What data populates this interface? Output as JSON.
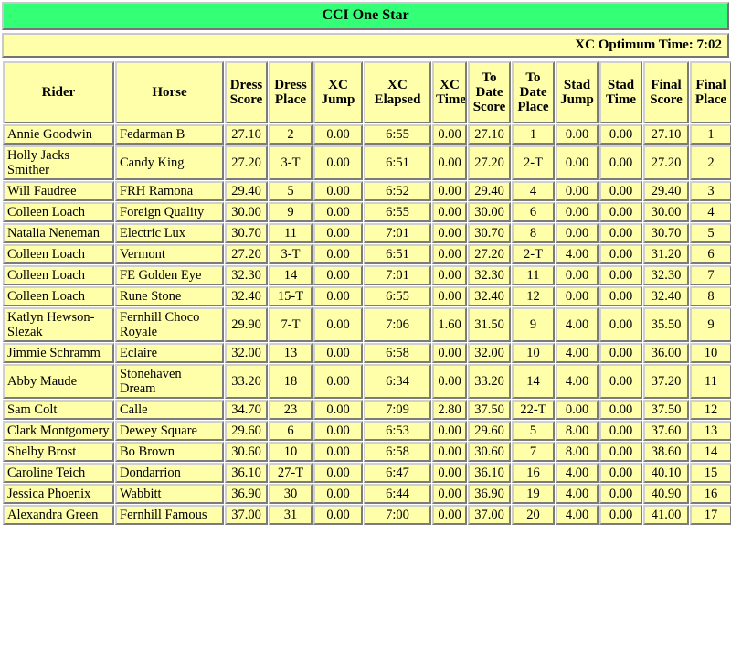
{
  "banner": {
    "title": "CCI One Star",
    "optimum_time_label": "XC Optimum Time: 7:02",
    "banner_color": "#33ff77",
    "cell_color": "#ffffaa"
  },
  "table": {
    "columns": [
      {
        "key": "rider",
        "label": "Rider"
      },
      {
        "key": "horse",
        "label": "Horse"
      },
      {
        "key": "dress_score",
        "label": "Dress Score"
      },
      {
        "key": "dress_place",
        "label": "Dress Place"
      },
      {
        "key": "xc_jump",
        "label": "XC Jump"
      },
      {
        "key": "xc_elapsed",
        "label": "XC Elapsed"
      },
      {
        "key": "xc_time",
        "label": "XC Time"
      },
      {
        "key": "td_score",
        "label": "To Date Score"
      },
      {
        "key": "td_place",
        "label": "To Date Place"
      },
      {
        "key": "stad_jump",
        "label": "Stad Jump"
      },
      {
        "key": "stad_time",
        "label": "Stad Time"
      },
      {
        "key": "final_score",
        "label": "Final Score"
      },
      {
        "key": "final_place",
        "label": "Final Place"
      }
    ],
    "rows": [
      {
        "rider": "Annie Goodwin",
        "horse": "Fedarman B",
        "dress_score": "27.10",
        "dress_place": "2",
        "xc_jump": "0.00",
        "xc_elapsed": "6:55",
        "xc_time": "0.00",
        "td_score": "27.10",
        "td_place": "1",
        "stad_jump": "0.00",
        "stad_time": "0.00",
        "final_score": "27.10",
        "final_place": "1"
      },
      {
        "rider": "Holly Jacks Smither",
        "horse": "Candy King",
        "dress_score": "27.20",
        "dress_place": "3-T",
        "xc_jump": "0.00",
        "xc_elapsed": "6:51",
        "xc_time": "0.00",
        "td_score": "27.20",
        "td_place": "2-T",
        "stad_jump": "0.00",
        "stad_time": "0.00",
        "final_score": "27.20",
        "final_place": "2"
      },
      {
        "rider": "Will Faudree",
        "horse": "FRH Ramona",
        "dress_score": "29.40",
        "dress_place": "5",
        "xc_jump": "0.00",
        "xc_elapsed": "6:52",
        "xc_time": "0.00",
        "td_score": "29.40",
        "td_place": "4",
        "stad_jump": "0.00",
        "stad_time": "0.00",
        "final_score": "29.40",
        "final_place": "3"
      },
      {
        "rider": "Colleen Loach",
        "horse": "Foreign Quality",
        "dress_score": "30.00",
        "dress_place": "9",
        "xc_jump": "0.00",
        "xc_elapsed": "6:55",
        "xc_time": "0.00",
        "td_score": "30.00",
        "td_place": "6",
        "stad_jump": "0.00",
        "stad_time": "0.00",
        "final_score": "30.00",
        "final_place": "4"
      },
      {
        "rider": "Natalia Neneman",
        "horse": "Electric Lux",
        "dress_score": "30.70",
        "dress_place": "11",
        "xc_jump": "0.00",
        "xc_elapsed": "7:01",
        "xc_time": "0.00",
        "td_score": "30.70",
        "td_place": "8",
        "stad_jump": "0.00",
        "stad_time": "0.00",
        "final_score": "30.70",
        "final_place": "5"
      },
      {
        "rider": "Colleen Loach",
        "horse": "Vermont",
        "dress_score": "27.20",
        "dress_place": "3-T",
        "xc_jump": "0.00",
        "xc_elapsed": "6:51",
        "xc_time": "0.00",
        "td_score": "27.20",
        "td_place": "2-T",
        "stad_jump": "4.00",
        "stad_time": "0.00",
        "final_score": "31.20",
        "final_place": "6"
      },
      {
        "rider": "Colleen Loach",
        "horse": "FE Golden Eye",
        "dress_score": "32.30",
        "dress_place": "14",
        "xc_jump": "0.00",
        "xc_elapsed": "7:01",
        "xc_time": "0.00",
        "td_score": "32.30",
        "td_place": "11",
        "stad_jump": "0.00",
        "stad_time": "0.00",
        "final_score": "32.30",
        "final_place": "7"
      },
      {
        "rider": "Colleen Loach",
        "horse": "Rune Stone",
        "dress_score": "32.40",
        "dress_place": "15-T",
        "xc_jump": "0.00",
        "xc_elapsed": "6:55",
        "xc_time": "0.00",
        "td_score": "32.40",
        "td_place": "12",
        "stad_jump": "0.00",
        "stad_time": "0.00",
        "final_score": "32.40",
        "final_place": "8"
      },
      {
        "rider": "Katlyn Hewson-Slezak",
        "horse": "Fernhill Choco Royale",
        "dress_score": "29.90",
        "dress_place": "7-T",
        "xc_jump": "0.00",
        "xc_elapsed": "7:06",
        "xc_time": "1.60",
        "td_score": "31.50",
        "td_place": "9",
        "stad_jump": "4.00",
        "stad_time": "0.00",
        "final_score": "35.50",
        "final_place": "9"
      },
      {
        "rider": "Jimmie Schramm",
        "horse": "Eclaire",
        "dress_score": "32.00",
        "dress_place": "13",
        "xc_jump": "0.00",
        "xc_elapsed": "6:58",
        "xc_time": "0.00",
        "td_score": "32.00",
        "td_place": "10",
        "stad_jump": "4.00",
        "stad_time": "0.00",
        "final_score": "36.00",
        "final_place": "10"
      },
      {
        "rider": "Abby Maude",
        "horse": "Stonehaven Dream",
        "dress_score": "33.20",
        "dress_place": "18",
        "xc_jump": "0.00",
        "xc_elapsed": "6:34",
        "xc_time": "0.00",
        "td_score": "33.20",
        "td_place": "14",
        "stad_jump": "4.00",
        "stad_time": "0.00",
        "final_score": "37.20",
        "final_place": "11"
      },
      {
        "rider": "Sam Colt",
        "horse": "Calle",
        "dress_score": "34.70",
        "dress_place": "23",
        "xc_jump": "0.00",
        "xc_elapsed": "7:09",
        "xc_time": "2.80",
        "td_score": "37.50",
        "td_place": "22-T",
        "stad_jump": "0.00",
        "stad_time": "0.00",
        "final_score": "37.50",
        "final_place": "12"
      },
      {
        "rider": "Clark Montgomery",
        "horse": "Dewey Square",
        "dress_score": "29.60",
        "dress_place": "6",
        "xc_jump": "0.00",
        "xc_elapsed": "6:53",
        "xc_time": "0.00",
        "td_score": "29.60",
        "td_place": "5",
        "stad_jump": "8.00",
        "stad_time": "0.00",
        "final_score": "37.60",
        "final_place": "13"
      },
      {
        "rider": "Shelby Brost",
        "horse": "Bo Brown",
        "dress_score": "30.60",
        "dress_place": "10",
        "xc_jump": "0.00",
        "xc_elapsed": "6:58",
        "xc_time": "0.00",
        "td_score": "30.60",
        "td_place": "7",
        "stad_jump": "8.00",
        "stad_time": "0.00",
        "final_score": "38.60",
        "final_place": "14"
      },
      {
        "rider": "Caroline Teich",
        "horse": "Dondarrion",
        "dress_score": "36.10",
        "dress_place": "27-T",
        "xc_jump": "0.00",
        "xc_elapsed": "6:47",
        "xc_time": "0.00",
        "td_score": "36.10",
        "td_place": "16",
        "stad_jump": "4.00",
        "stad_time": "0.00",
        "final_score": "40.10",
        "final_place": "15"
      },
      {
        "rider": "Jessica Phoenix",
        "horse": "Wabbitt",
        "dress_score": "36.90",
        "dress_place": "30",
        "xc_jump": "0.00",
        "xc_elapsed": "6:44",
        "xc_time": "0.00",
        "td_score": "36.90",
        "td_place": "19",
        "stad_jump": "4.00",
        "stad_time": "0.00",
        "final_score": "40.90",
        "final_place": "16"
      },
      {
        "rider": "Alexandra Green",
        "horse": "Fernhill Famous",
        "dress_score": "37.00",
        "dress_place": "31",
        "xc_jump": "0.00",
        "xc_elapsed": "7:00",
        "xc_time": "0.00",
        "td_score": "37.00",
        "td_place": "20",
        "stad_jump": "4.00",
        "stad_time": "0.00",
        "final_score": "41.00",
        "final_place": "17"
      }
    ]
  }
}
